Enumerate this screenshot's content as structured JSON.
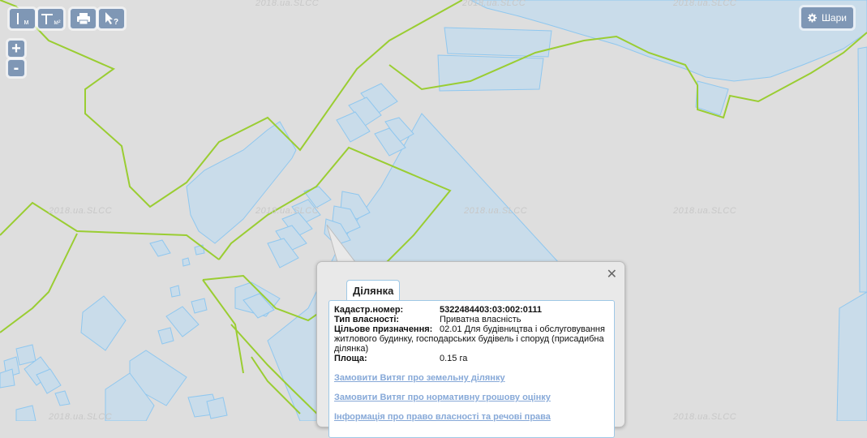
{
  "toolbar": {
    "measure_length_label": "м",
    "measure_area_label": "м²",
    "print_icon": "printer-icon",
    "identify_icon": "cursor-question-icon"
  },
  "zoom": {
    "in_label": "+",
    "out_label": "-"
  },
  "layers_button": {
    "label": "Шари",
    "icon": "gear-icon"
  },
  "watermark": "2018.ua.SLCC",
  "popup": {
    "tab_label": "Ділянка",
    "fields": [
      {
        "key": "Кадастр.номер:",
        "value": "5322484403:03:002:0111"
      },
      {
        "key": "Тип власності:",
        "value": "Приватна власність"
      },
      {
        "key": "Цільове призначення:",
        "value": "02.01 Для будівництва і обслуговування житлового будинку, господарських будівель і споруд (присадибна ділянка)"
      },
      {
        "key": "Площа:",
        "value": "0.15 га"
      }
    ],
    "links": [
      "Замовити Витяг про земельну ділянку",
      "Замовити Витяг про нормативну грошову оцінку",
      "Інформація про право власності та речові права"
    ]
  },
  "colors": {
    "map_background": "#dedede",
    "parcel_fill": "#c9dcea",
    "parcel_stroke": "#8fc7ef",
    "boundary_green": "#9acd32",
    "control_bg": "#7f97b5",
    "link": "#87a9d8"
  }
}
